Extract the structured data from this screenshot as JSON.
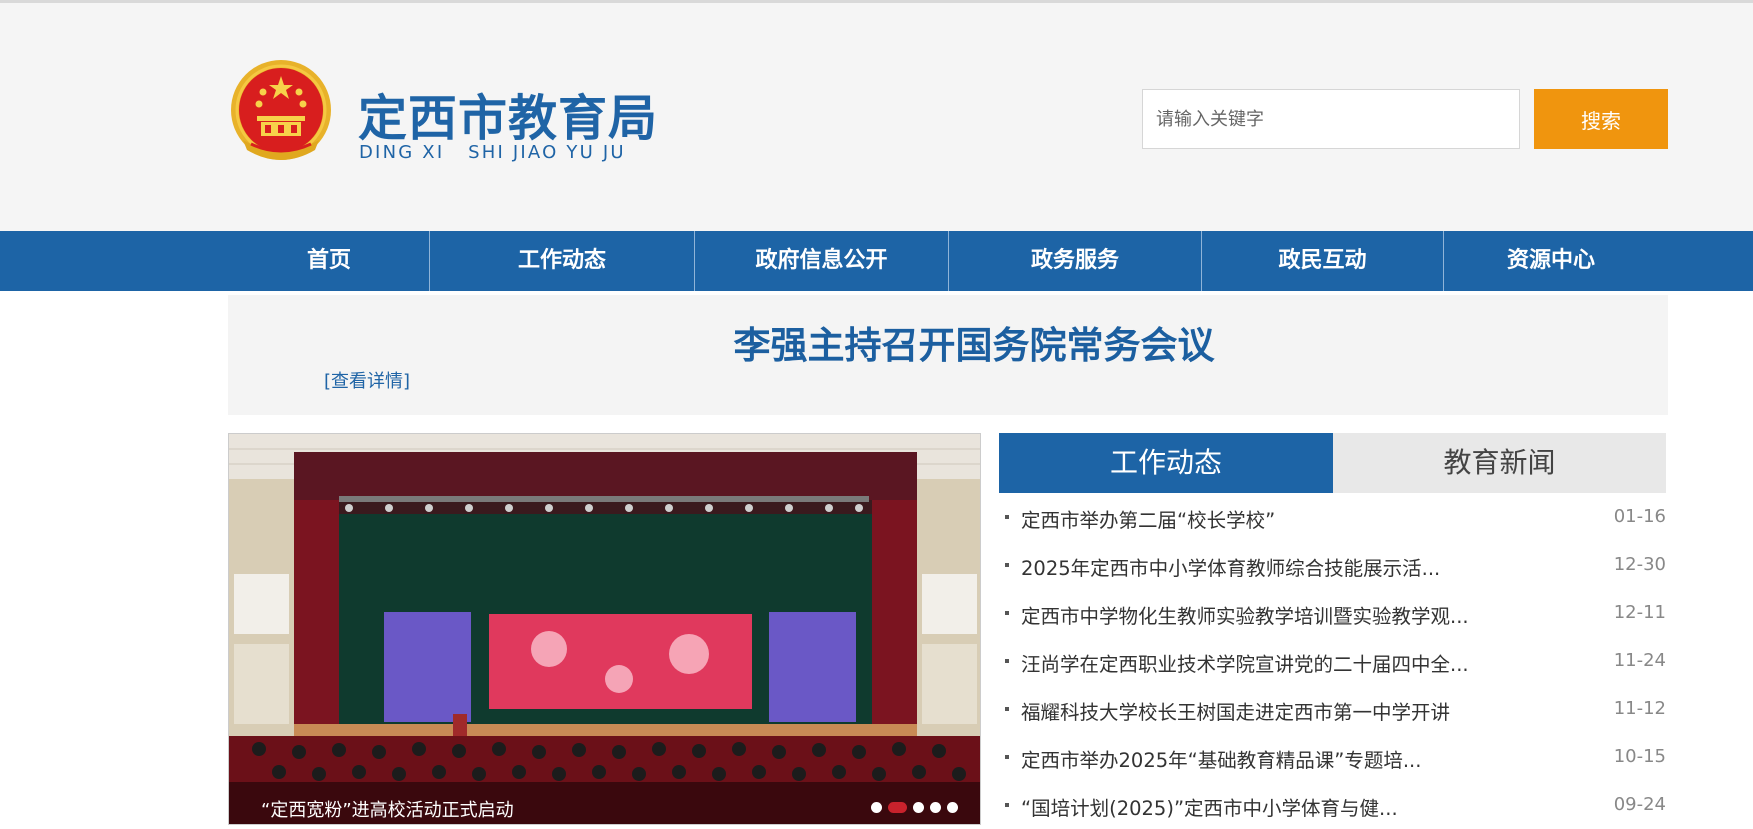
{
  "header": {
    "title": "定西市教育局",
    "subtitle": "DING XI   SHI JIAO YU JU",
    "search": {
      "placeholder": "请输入关键字",
      "value": "",
      "button_label": "搜索"
    }
  },
  "nav": {
    "items": [
      {
        "label": "首页"
      },
      {
        "label": "工作动态"
      },
      {
        "label": "政府信息公开"
      },
      {
        "label": "政务服务"
      },
      {
        "label": "政民互动"
      },
      {
        "label": "资源中心"
      }
    ]
  },
  "headline": {
    "title": "李强主持召开国务院常务会议",
    "detail_link": "[查看详情]"
  },
  "slideshow": {
    "caption": "“定西宽粉”进高校活动正式启动",
    "slide_count": 5,
    "active_index": 1
  },
  "news": {
    "tabs": [
      {
        "label": "工作动态",
        "active": true
      },
      {
        "label": "教育新闻",
        "active": false
      }
    ],
    "items": [
      {
        "title": "定西市举办第二届“校长学校”",
        "date": "01-16"
      },
      {
        "title": "2025年定西市中小学体育教师综合技能展示活...",
        "date": "12-30"
      },
      {
        "title": "定西市中学物化生教师实验教学培训暨实验教学观...",
        "date": "12-11"
      },
      {
        "title": "汪尚学在定西职业技术学院宣讲党的二十届四中全...",
        "date": "11-24"
      },
      {
        "title": "福耀科技大学校长王树国走进定西市第一中学开讲",
        "date": "11-12"
      },
      {
        "title": "定西市举办2025年“基础教育精品课”专题培...",
        "date": "10-15"
      },
      {
        "title": "“国培计划(2025)”定西市中小学体育与健...",
        "date": "09-24"
      }
    ]
  },
  "colors": {
    "brand_blue": "#1d64a6",
    "search_orange": "#f0950e",
    "active_dot_red": "#c8222c"
  }
}
